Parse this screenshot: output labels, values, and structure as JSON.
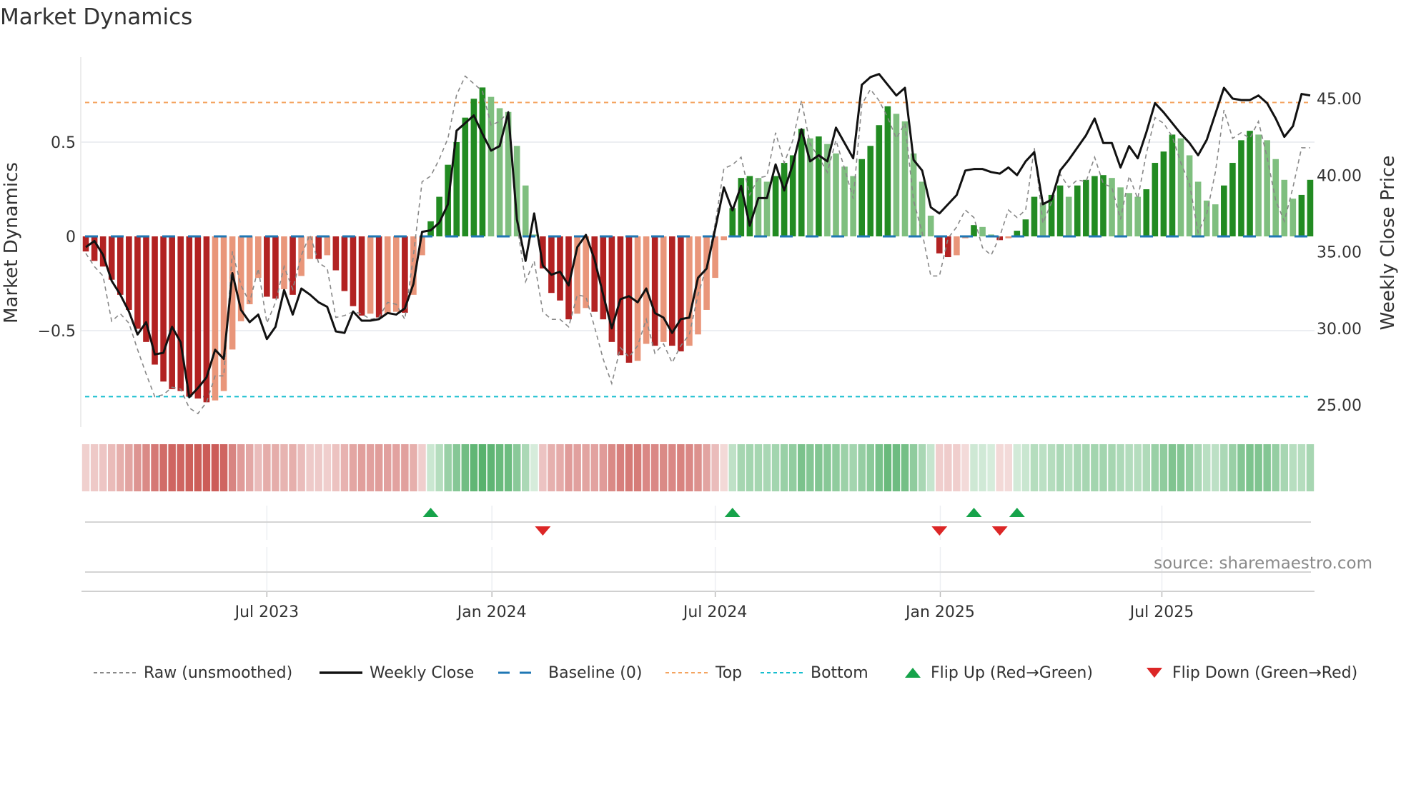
{
  "title": "Market Dynamics",
  "source": "source: sharemaestro.com",
  "colors": {
    "dark_red": "#b22222",
    "light_red": "#e9967a",
    "dark_green": "#228b22",
    "light_green": "#7fbf7f",
    "baseline": "#1f77b4",
    "top": "#f4a460",
    "bottom": "#17becf",
    "flip_up": "#16a34a",
    "flip_down": "#dc2626",
    "close": "#111111",
    "raw": "#888888",
    "strip_red": "200,80,75",
    "strip_green": "60,165,85"
  },
  "legend": [
    {
      "key": "raw",
      "label": "Raw (unsmoothed)"
    },
    {
      "key": "close",
      "label": "Weekly Close"
    },
    {
      "key": "baseline",
      "label": "Baseline (0)"
    },
    {
      "key": "top",
      "label": "Top"
    },
    {
      "key": "bottom",
      "label": "Bottom"
    },
    {
      "key": "flip_up",
      "label": "Flip Up (Red→Green)"
    },
    {
      "key": "flip_down",
      "label": "Flip Down (Green→Red)"
    }
  ],
  "chart_data": {
    "type": "bar",
    "title": "Market Dynamics",
    "ylabel": "Market Dynamics",
    "y2label": "Weekly Close Price",
    "x_unit": "week index",
    "left_ticks": [
      {
        "v": 0.5,
        "label": "0.5"
      },
      {
        "v": 0,
        "label": "0"
      },
      {
        "v": -0.5,
        "label": "−0.5"
      }
    ],
    "right_ticks": [
      {
        "v": 45,
        "label": "45.00"
      },
      {
        "v": 40,
        "label": "40.00"
      },
      {
        "v": 35,
        "label": "35.00"
      },
      {
        "v": 30,
        "label": "30.00"
      },
      {
        "v": 25,
        "label": "25.00"
      }
    ],
    "x_ticks": [
      {
        "i": 21.0,
        "label": "Jul 2023"
      },
      {
        "i": 47.1,
        "label": "Jan 2024"
      },
      {
        "i": 73.0,
        "label": "Jul 2024"
      },
      {
        "i": 99.1,
        "label": "Jan 2025"
      },
      {
        "i": 124.8,
        "label": "Jul 2025"
      }
    ],
    "top_level": 0.71,
    "bottom_level": -0.85,
    "baseline": 0,
    "histogram": [
      -0.08,
      -0.13,
      -0.16,
      -0.23,
      -0.31,
      -0.39,
      -0.49,
      -0.56,
      -0.68,
      -0.77,
      -0.81,
      -0.82,
      -0.85,
      -0.86,
      -0.88,
      -0.87,
      -0.82,
      -0.6,
      -0.45,
      -0.36,
      -0.22,
      -0.32,
      -0.33,
      -0.28,
      -0.31,
      -0.21,
      -0.12,
      -0.12,
      -0.1,
      -0.18,
      -0.29,
      -0.37,
      -0.42,
      -0.41,
      -0.43,
      -0.41,
      -0.4,
      -0.405,
      -0.31,
      -0.1,
      0.08,
      0.21,
      0.38,
      0.5,
      0.63,
      0.73,
      0.79,
      0.74,
      0.68,
      0.66,
      0.48,
      0.27,
      0.01,
      -0.17,
      -0.3,
      -0.34,
      -0.44,
      -0.41,
      -0.38,
      -0.4,
      -0.44,
      -0.56,
      -0.63,
      -0.67,
      -0.66,
      -0.57,
      -0.58,
      -0.56,
      -0.58,
      -0.61,
      -0.58,
      -0.52,
      -0.39,
      -0.22,
      -0.02,
      0.15,
      0.31,
      0.32,
      0.31,
      0.29,
      0.32,
      0.39,
      0.43,
      0.57,
      0.52,
      0.53,
      0.49,
      0.44,
      0.37,
      0.32,
      0.41,
      0.48,
      0.59,
      0.69,
      0.65,
      0.61,
      0.44,
      0.29,
      0.11,
      -0.09,
      -0.11,
      -0.1,
      -0.01,
      0.06,
      0.05,
      0.01,
      -0.02,
      -0.01,
      0.03,
      0.09,
      0.21,
      0.18,
      0.22,
      0.27,
      0.21,
      0.27,
      0.3,
      0.32,
      0.325,
      0.31,
      0.26,
      0.23,
      0.21,
      0.25,
      0.39,
      0.45,
      0.54,
      0.52,
      0.43,
      0.29,
      0.19,
      0.17,
      0.27,
      0.39,
      0.51,
      0.56,
      0.54,
      0.51,
      0.41,
      0.3,
      0.2,
      0.22,
      0.3
    ],
    "raw": [
      -0.09,
      -0.16,
      -0.21,
      -0.45,
      -0.41,
      -0.46,
      -0.6,
      -0.73,
      -0.85,
      -0.84,
      -0.8,
      -0.81,
      -0.91,
      -0.94,
      -0.88,
      -0.74,
      -0.74,
      -0.08,
      -0.26,
      -0.35,
      -0.17,
      -0.46,
      -0.35,
      -0.16,
      -0.28,
      -0.1,
      0.01,
      -0.14,
      -0.17,
      -0.43,
      -0.42,
      -0.4,
      -0.41,
      -0.44,
      -0.43,
      -0.35,
      -0.36,
      -0.44,
      -0.1,
      0.29,
      0.32,
      0.41,
      0.52,
      0.75,
      0.85,
      0.81,
      0.77,
      0.59,
      0.61,
      0.66,
      0.07,
      -0.24,
      -0.13,
      -0.4,
      -0.44,
      -0.44,
      -0.48,
      -0.31,
      -0.32,
      -0.48,
      -0.65,
      -0.78,
      -0.59,
      -0.64,
      -0.58,
      -0.44,
      -0.62,
      -0.57,
      -0.67,
      -0.58,
      -0.52,
      -0.31,
      -0.16,
      0.07,
      0.36,
      0.38,
      0.42,
      0.22,
      0.31,
      0.32,
      0.55,
      0.39,
      0.51,
      0.72,
      0.49,
      0.42,
      0.34,
      0.51,
      0.36,
      0.2,
      0.7,
      0.78,
      0.72,
      0.63,
      0.52,
      0.6,
      0.19,
      0.02,
      -0.21,
      -0.21,
      -0.01,
      0.05,
      0.14,
      0.1,
      -0.06,
      -0.1,
      0.0,
      0.14,
      0.1,
      0.14,
      0.47,
      0.07,
      0.18,
      0.33,
      0.26,
      0.3,
      0.29,
      0.42,
      0.28,
      0.26,
      0.09,
      0.32,
      0.2,
      0.44,
      0.63,
      0.6,
      0.53,
      0.39,
      0.28,
      0.02,
      0.12,
      0.34,
      0.67,
      0.52,
      0.55,
      0.52,
      0.61,
      0.42,
      0.19,
      0.08,
      0.26,
      0.47,
      0.47
    ],
    "weekly_close": [
      35.3,
      35.7,
      34.8,
      33.1,
      32.2,
      31.1,
      29.6,
      30.4,
      28.3,
      28.4,
      30.1,
      29.1,
      25.5,
      26.1,
      26.8,
      28.6,
      28.0,
      33.6,
      31.2,
      30.4,
      30.9,
      29.3,
      30.1,
      32.5,
      30.9,
      32.6,
      32.2,
      31.7,
      31.4,
      29.8,
      29.7,
      31.1,
      30.5,
      30.5,
      30.6,
      31.0,
      30.9,
      31.3,
      32.9,
      36.3,
      36.4,
      36.9,
      38.1,
      42.9,
      43.4,
      43.9,
      42.7,
      41.6,
      41.9,
      44.1,
      37.1,
      34.4,
      37.5,
      34.1,
      33.5,
      33.7,
      32.8,
      35.3,
      36.1,
      34.5,
      32.2,
      30.0,
      31.9,
      32.1,
      31.7,
      32.6,
      31.0,
      30.7,
      29.7,
      30.6,
      30.7,
      33.3,
      33.9,
      36.5,
      39.2,
      37.7,
      39.3,
      36.7,
      38.5,
      38.5,
      40.7,
      39.0,
      40.7,
      43.0,
      40.9,
      41.3,
      40.9,
      43.1,
      42.1,
      41.1,
      45.9,
      46.4,
      46.6,
      45.9,
      45.2,
      45.7,
      41.0,
      40.3,
      37.9,
      37.5,
      38.1,
      38.7,
      40.3,
      40.4,
      40.4,
      40.2,
      40.1,
      40.5,
      40.0,
      40.9,
      41.5,
      38.1,
      38.4,
      40.3,
      41.0,
      41.8,
      42.6,
      43.7,
      42.1,
      42.1,
      40.5,
      41.9,
      41.1,
      42.8,
      44.7,
      44.1,
      43.4,
      42.7,
      42.1,
      41.3,
      42.3,
      44.0,
      45.7,
      45.0,
      44.9,
      44.9,
      45.2,
      44.7,
      43.7,
      42.5,
      43.2,
      45.3,
      45.2
    ],
    "flip_up": [
      40,
      75,
      103,
      108
    ],
    "flip_down": [
      53,
      99,
      106
    ],
    "ylim": [
      -0.93,
      0.9
    ],
    "y2lim": [
      24.3,
      47.5
    ]
  }
}
